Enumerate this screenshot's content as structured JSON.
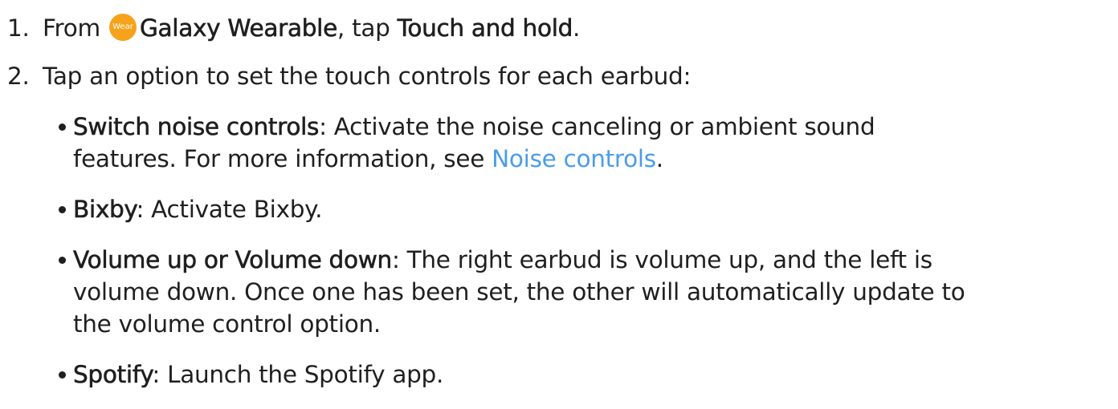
{
  "steps": [
    {
      "number": "1.",
      "pre": "From ",
      "icon_label": "Wear",
      "app": "Galaxy Wearable",
      "mid": ", tap ",
      "target": "Touch and hold",
      "end": "."
    },
    {
      "number": "2.",
      "text": "Tap an option to set the touch controls for each earbud:"
    }
  ],
  "options": [
    {
      "term": "Switch noise controls",
      "sep": ":",
      "lines": [
        "Activate the noise canceling or ambient sound",
        "features. For more information, see "
      ],
      "link": "Noise controls",
      "after_link": "."
    },
    {
      "term": "Bixby",
      "sep": ":",
      "lines": [
        "Activate Bixby."
      ]
    },
    {
      "term": "Volume up or Volume down",
      "sep": ":",
      "lines": [
        "The right earbud is volume up, and the left is",
        "volume down. Once one has been set, the other will automatically update to",
        "the volume control option."
      ]
    },
    {
      "term": "Spotify",
      "sep": ":",
      "lines": [
        "Launch the Spotify app."
      ]
    }
  ],
  "colors": {
    "text": "#1f1f1f",
    "link": "#4a9de8",
    "wear_icon_bg": "#f7a21b"
  }
}
